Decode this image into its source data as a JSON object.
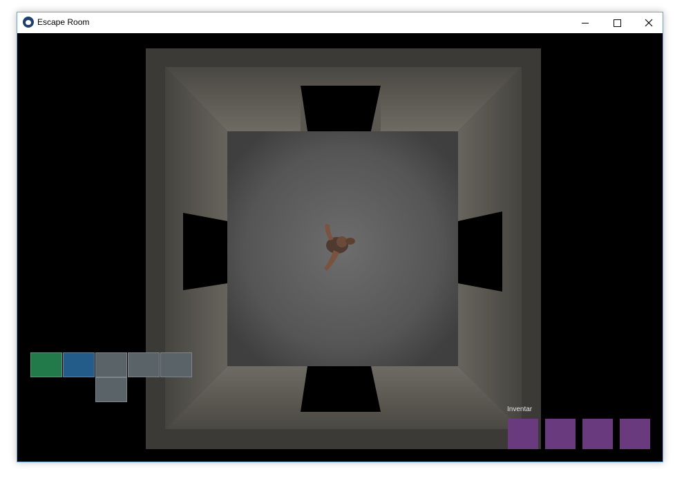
{
  "window": {
    "title": "Escape Room",
    "app_icon": "paw-icon",
    "controls": [
      "minimize-icon",
      "maximize-icon",
      "close-icon"
    ]
  },
  "game": {
    "view": "top-down room",
    "room_layout": "square room with doorway openings on north, south, east and west walls",
    "player": "character standing in center of room"
  },
  "minimap": {
    "cells": [
      {
        "state": "current",
        "color": "#22794a"
      },
      {
        "state": "visited",
        "color": "#235c88"
      },
      {
        "state": "unvisited",
        "color": "#5a6367"
      },
      {
        "state": "unvisited",
        "color": "#5a6367"
      },
      {
        "state": "unvisited",
        "color": "#5a6367"
      },
      {
        "state": "unvisited",
        "color": "#5a6367"
      }
    ]
  },
  "inventory": {
    "label": "Inventar",
    "slot_color": "#6a3a7e",
    "slots": [
      "",
      "",
      "",
      ""
    ]
  }
}
